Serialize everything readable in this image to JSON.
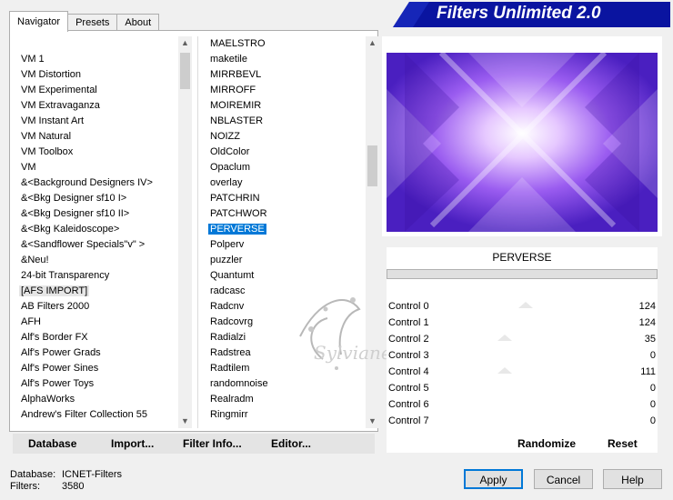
{
  "tabs": [
    {
      "label": "Navigator"
    },
    {
      "label": "Presets"
    },
    {
      "label": "About"
    }
  ],
  "banner": {
    "title": "Filters Unlimited 2.0"
  },
  "categories": [
    "VM 1",
    "VM Distortion",
    "VM Experimental",
    "VM Extravaganza",
    "VM Instant Art",
    "VM Natural",
    "VM Toolbox",
    "VM",
    "&<Background Designers IV>",
    "&<Bkg Designer sf10 I>",
    "&<Bkg Designer sf10 II>",
    "&<Bkg Kaleidoscope>",
    "&<Sandflower Specials\"v\" >",
    "&Neu!",
    "24-bit Transparency",
    "[AFS IMPORT]",
    "AB Filters 2000",
    "AFH",
    "Alf's Border FX",
    "Alf's Power Grads",
    "Alf's Power Sines",
    "Alf's Power Toys",
    "AlphaWorks",
    "Andrew's Filter Collection 55"
  ],
  "filters": [
    "MAELSTRO",
    "maketile",
    "MIRRBEVL",
    "MIRROFF",
    "MOIREMIR",
    "NBLASTER",
    "NOIZZ",
    "OldColor",
    "Opaclum",
    "overlay",
    "PATCHRIN",
    "PATCHWOR",
    "PERVERSE",
    "Polperv",
    "puzzler",
    "Quantumt",
    "radcasc",
    "Radcnv",
    "Radcovrg",
    "Radialzi",
    "Radstrea",
    "Radtilem",
    "randomnoise",
    "Realradm",
    "Ringmirr"
  ],
  "selected_category": "[AFS IMPORT]",
  "selected_filter": "PERVERSE",
  "filter_name": "PERVERSE",
  "watermark_text": "Sylviane",
  "controls": [
    {
      "label": "Control 0",
      "value": "124"
    },
    {
      "label": "Control 1",
      "value": "124"
    },
    {
      "label": "Control 2",
      "value": "35"
    },
    {
      "label": "Control 3",
      "value": "0"
    },
    {
      "label": "Control 4",
      "value": "111"
    },
    {
      "label": "Control 5",
      "value": "0"
    },
    {
      "label": "Control 6",
      "value": "0"
    },
    {
      "label": "Control 7",
      "value": "0"
    }
  ],
  "toolbar": {
    "database": "Database",
    "import": "Import...",
    "filter_info": "Filter Info...",
    "editor": "Editor...",
    "randomize": "Randomize",
    "reset": "Reset"
  },
  "status": {
    "database_label": "Database:",
    "database_value": "ICNET-Filters",
    "filters_label": "Filters:",
    "filters_value": "3580"
  },
  "buttons": {
    "apply": "Apply",
    "cancel": "Cancel",
    "help": "Help"
  },
  "colors": {
    "banner_blue": "#0a14a0",
    "selection_blue": "#0078d7",
    "preview_purple": "#7b3fe4"
  }
}
